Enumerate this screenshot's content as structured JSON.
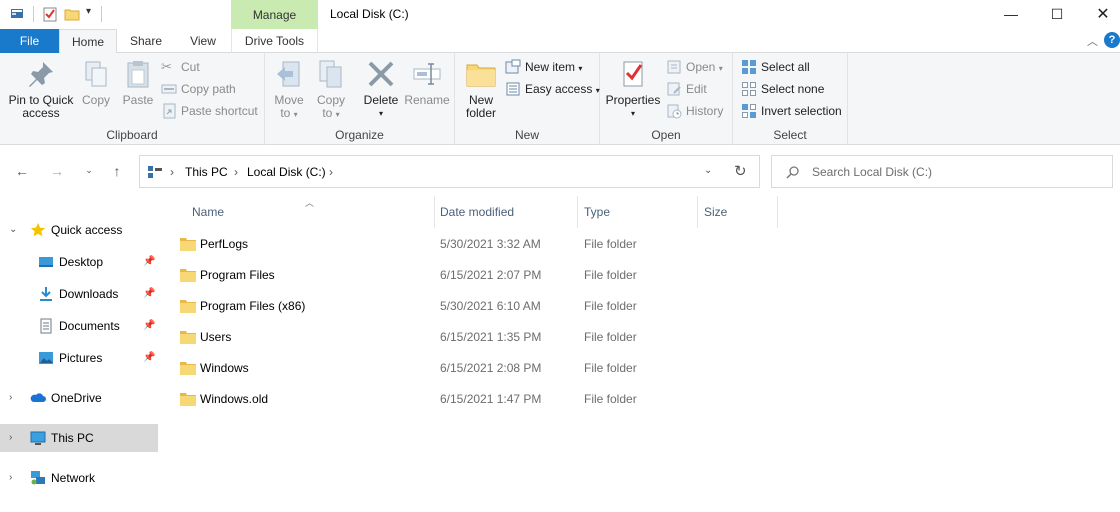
{
  "window": {
    "title": "Local Disk (C:)",
    "contextual_tab": "Manage"
  },
  "ribbon_tabs": {
    "file": "File",
    "home": "Home",
    "share": "Share",
    "view": "View",
    "drive_tools": "Drive Tools"
  },
  "ribbon": {
    "clipboard": {
      "label": "Clipboard",
      "pin_line1": "Pin to Quick",
      "pin_line2": "access",
      "copy": "Copy",
      "paste": "Paste",
      "cut": "Cut",
      "copy_path": "Copy path",
      "paste_shortcut": "Paste shortcut"
    },
    "organize": {
      "label": "Organize",
      "move_to_line1": "Move",
      "move_to_line2": "to",
      "copy_to_line1": "Copy",
      "copy_to_line2": "to",
      "delete": "Delete",
      "rename": "Rename"
    },
    "new": {
      "label": "New",
      "new_folder_line1": "New",
      "new_folder_line2": "folder",
      "new_item": "New item",
      "easy_access": "Easy access"
    },
    "open": {
      "label": "Open",
      "properties": "Properties",
      "open": "Open",
      "edit": "Edit",
      "history": "History"
    },
    "select": {
      "label": "Select",
      "select_all": "Select all",
      "select_none": "Select none",
      "invert_selection": "Invert selection"
    }
  },
  "address": {
    "crumbs": [
      "This PC",
      "Local Disk (C:)"
    ]
  },
  "search": {
    "placeholder": "Search Local Disk (C:)"
  },
  "sidebar": {
    "quick_access": "Quick access",
    "items": [
      {
        "label": "Desktop",
        "icon": "desktop-icon"
      },
      {
        "label": "Downloads",
        "icon": "downloads-icon"
      },
      {
        "label": "Documents",
        "icon": "documents-icon"
      },
      {
        "label": "Pictures",
        "icon": "pictures-icon"
      }
    ],
    "onedrive": "OneDrive",
    "this_pc": "This PC",
    "network": "Network"
  },
  "columns": {
    "name": "Name",
    "date_modified": "Date modified",
    "type": "Type",
    "size": "Size"
  },
  "files": [
    {
      "name": "PerfLogs",
      "date": "5/30/2021 3:32 AM",
      "type": "File folder"
    },
    {
      "name": "Program Files",
      "date": "6/15/2021 2:07 PM",
      "type": "File folder"
    },
    {
      "name": "Program Files (x86)",
      "date": "5/30/2021 6:10 AM",
      "type": "File folder"
    },
    {
      "name": "Users",
      "date": "6/15/2021 1:35 PM",
      "type": "File folder"
    },
    {
      "name": "Windows",
      "date": "6/15/2021 2:08 PM",
      "type": "File folder"
    },
    {
      "name": "Windows.old",
      "date": "6/15/2021 1:47 PM",
      "type": "File folder"
    }
  ],
  "colors": {
    "accent": "#1979ca",
    "manage_tab": "#c9ebb1",
    "folder": "#f8d775",
    "selection": "#d9d9d9"
  }
}
